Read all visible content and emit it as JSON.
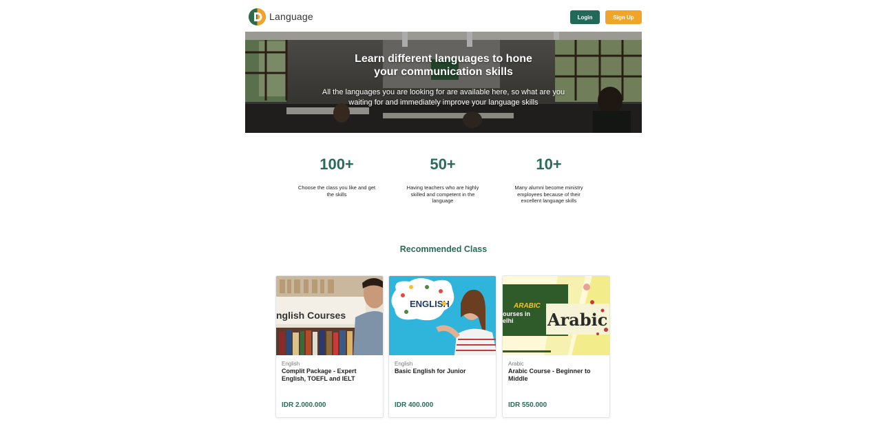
{
  "header": {
    "brand": "Language",
    "login_label": "Login",
    "signup_label": "Sign Up"
  },
  "hero": {
    "title_line1": "Learn different languages to hone",
    "title_line2": "your communication skills",
    "subtitle_line1": "All the languages you are looking for are available here, so what are you",
    "subtitle_line2": "waiting for and immediately improve your language skills"
  },
  "stats": [
    {
      "value": "100+",
      "line1": "Choose the class you like and get",
      "line2": "the skills",
      "line3": ""
    },
    {
      "value": "50+",
      "line1": "Having teachers who are highly",
      "line2": "skilled and competent in the",
      "line3": "language"
    },
    {
      "value": "10+",
      "line1": "Many alumni become ministry",
      "line2": "employees because of their",
      "line3": "excellent language skills"
    }
  ],
  "section": {
    "title": "Recommended Class"
  },
  "cards": [
    {
      "category": "English",
      "title_line1": "Complit Package - Expert",
      "title_line2": "English, TOEFL and IELT",
      "price": "IDR 2.000.000",
      "image_text": "nglish Courses"
    },
    {
      "category": "English",
      "title_line1": "Basic English for Junior",
      "title_line2": "",
      "price": "IDR 400.000",
      "image_text": "ENGLISH"
    },
    {
      "category": "Arabic",
      "title_line1": "Arabic Course - Beginner to",
      "title_line2": "Middle",
      "price": "IDR 550.000",
      "image_text_1": "ARABIC",
      "image_text_2": "ourses in",
      "image_text_3": "elhi",
      "image_text_4": "Arabic"
    }
  ],
  "colors": {
    "primary": "#22695a",
    "accent": "#f0a52a",
    "heading": "#2a6a58"
  }
}
